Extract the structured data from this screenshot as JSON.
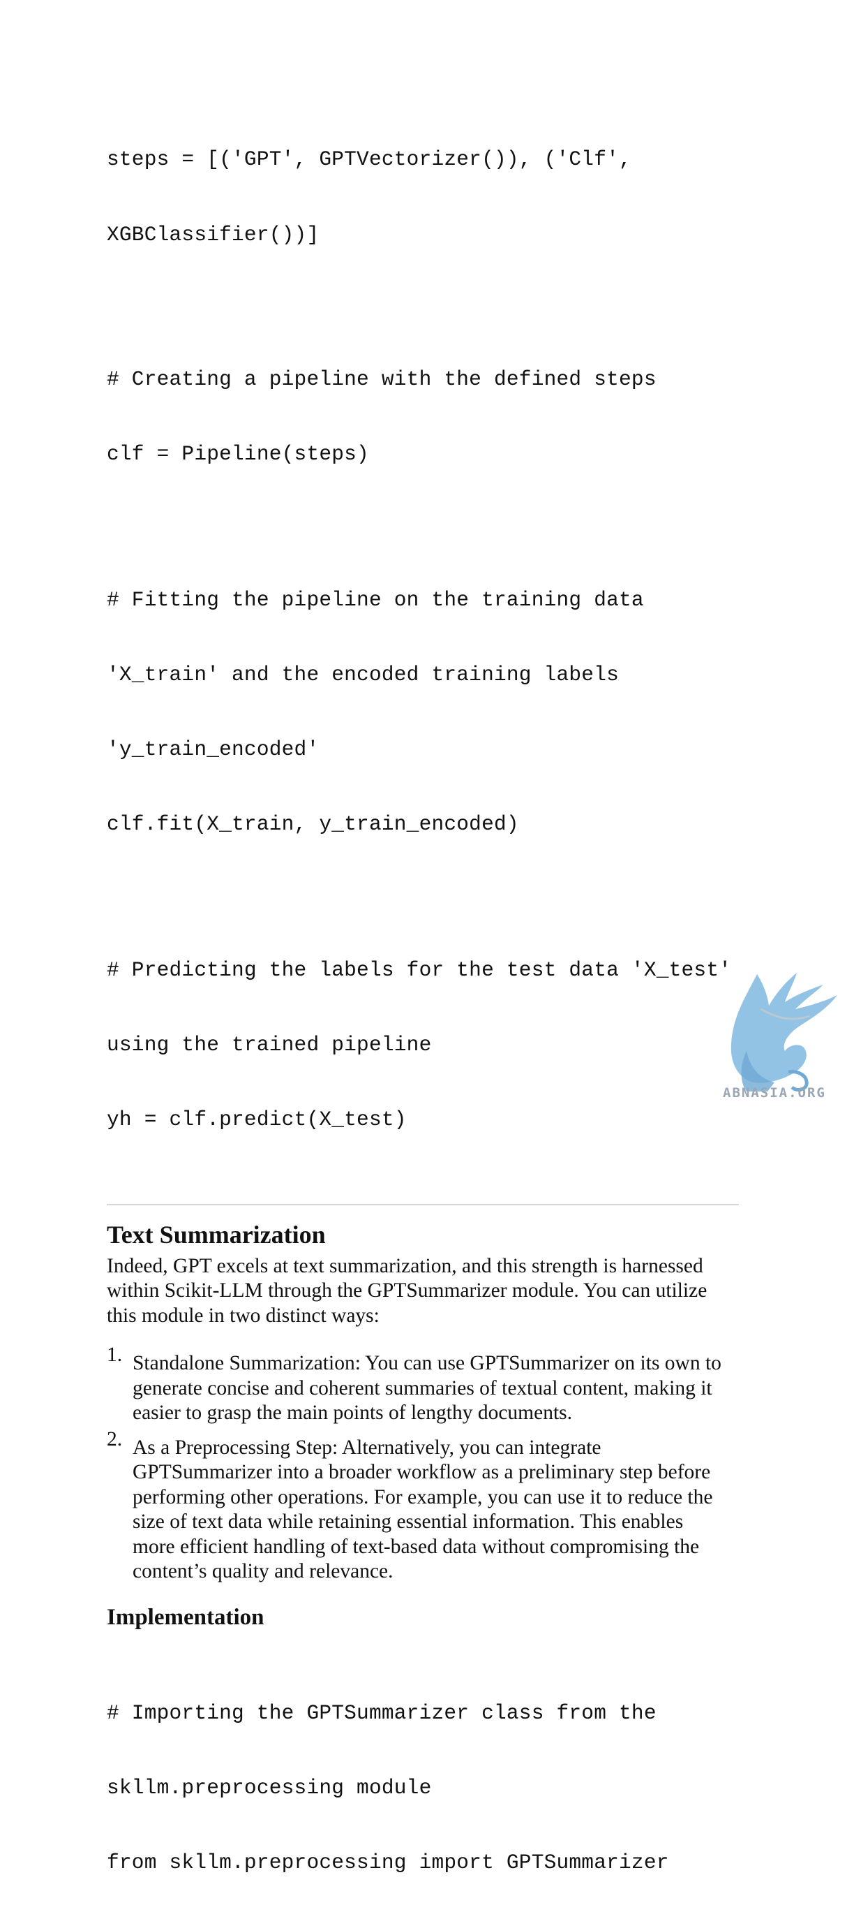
{
  "code_block_1": [
    "steps = [('GPT', GPTVectorizer()), ('Clf',",
    "XGBClassifier())]",
    "",
    "# Creating a pipeline with the defined steps",
    "clf = Pipeline(steps)",
    "",
    "# Fitting the pipeline on the training data",
    "'X_train' and the encoded training labels",
    "'y_train_encoded'",
    "clf.fit(X_train, y_train_encoded)",
    "",
    "# Predicting the labels for the test data 'X_test'",
    "using the trained pipeline",
    "yh = clf.predict(X_test)"
  ],
  "section": {
    "title": "Text Summarization",
    "intro": [
      "Indeed, GPT excels at text summarization, and this strength is harnessed",
      "within Scikit-LLM through the GPTSummarizer module. You can utilize",
      "this module in two distinct ways:"
    ],
    "list": [
      {
        "number": "1.",
        "lines": [
          "Standalone Summarization: You can use GPTSummarizer on its own to",
          "generate concise and coherent summaries of textual content, making it",
          "easier to grasp the main points of lengthy documents."
        ]
      },
      {
        "number": "2.",
        "lines": [
          "As a Preprocessing Step: Alternatively, you can integrate",
          "GPTSummarizer into a broader workflow as a preliminary step before",
          "performing other operations. For example, you can use it to reduce the",
          "size of text data while retaining essential information. This enables",
          "more efficient handling of text-based data without compromising the",
          "content’s quality and relevance."
        ]
      }
    ]
  },
  "implementation": {
    "title": "Implementation",
    "code": [
      "# Importing the GPTSummarizer class from the",
      "skllm.preprocessing module",
      "from skllm.preprocessing import GPTSummarizer"
    ]
  },
  "watermark": {
    "text": "ABNASIA.ORG",
    "color": "#7fb8e0"
  }
}
